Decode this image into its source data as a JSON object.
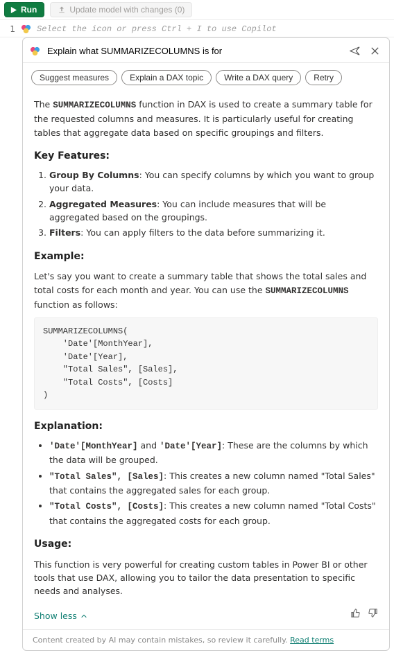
{
  "toolbar": {
    "run_label": "Run",
    "update_label": "Update model with changes (0)"
  },
  "editor": {
    "line_number": "1",
    "placeholder": "Select the icon or press Ctrl + I to use Copilot"
  },
  "panel": {
    "input_value": "Explain what SUMMARIZECOLUMNS is for",
    "chips": [
      "Suggest measures",
      "Explain a DAX topic",
      "Write a DAX query",
      "Retry"
    ]
  },
  "resp": {
    "intro_a": "The ",
    "intro_fn": "SUMMARIZECOLUMNS",
    "intro_b": " function in DAX is used to create a summary table for the requested columns and measures. It is particularly useful for creating tables that aggregate data based on specific groupings and filters.",
    "kf_heading": "Key Features:",
    "kf1_b": "Group By Columns",
    "kf1_t": ": You can specify columns by which you want to group your data.",
    "kf2_b": "Aggregated Measures",
    "kf2_t": ": You can include measures that will be aggregated based on the groupings.",
    "kf3_b": "Filters",
    "kf3_t": ": You can apply filters to the data before summarizing it.",
    "ex_heading": "Example:",
    "ex_intro_a": "Let's say you want to create a summary table that shows the total sales and total costs for each month and year. You can use the ",
    "ex_intro_fn": "SUMMARIZECOLUMNS",
    "ex_intro_b": " function as follows:",
    "code": "SUMMARIZECOLUMNS(\n    'Date'[MonthYear],\n    'Date'[Year],\n    \"Total Sales\", [Sales],\n    \"Total Costs\", [Costs]\n)",
    "expl_heading": "Explanation:",
    "e1_m": "'Date'[MonthYear]",
    "e1_mid": " and ",
    "e1_m2": "'Date'[Year]",
    "e1_t": ": These are the columns by which the data will be grouped.",
    "e2_m": "\"Total Sales\", [Sales]",
    "e2_t": ": This creates a new column named \"Total Sales\" that contains the aggregated sales for each group.",
    "e3_m": "\"Total Costs\", [Costs]",
    "e3_t": ": This creates a new column named \"Total Costs\" that contains the aggregated costs for each group.",
    "usage_heading": "Usage:",
    "usage_text": "This function is very powerful for creating custom tables in Power BI or other tools that use DAX, allowing you to tailor the data presentation to specific needs and analyses.",
    "show_less": "Show less"
  },
  "footer": {
    "disclaimer": "Content created by AI may contain mistakes, so review it carefully. ",
    "link": "Read terms"
  }
}
